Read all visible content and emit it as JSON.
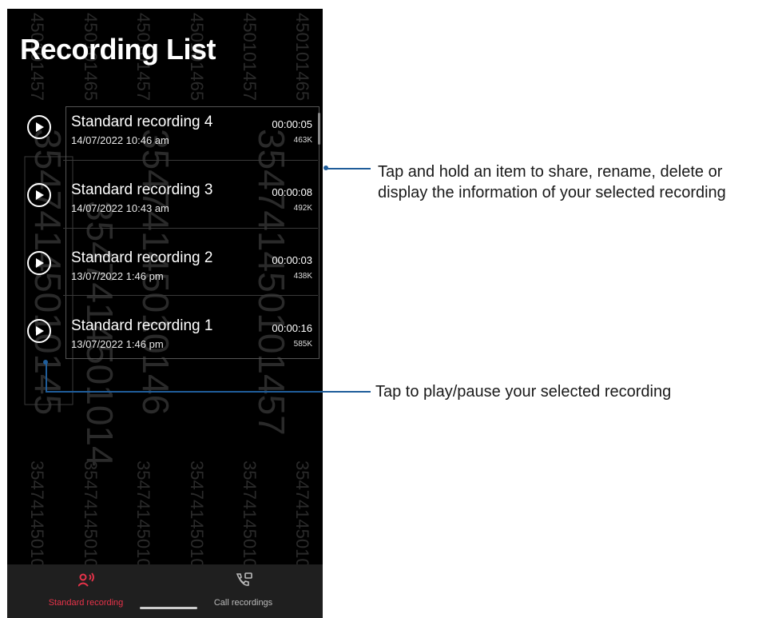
{
  "screen": {
    "title": "Recording List",
    "recordings": [
      {
        "name": "Standard recording 4",
        "date": "14/07/2022 10:46 am",
        "duration": "00:00:05",
        "size": "463K"
      },
      {
        "name": "Standard recording 3",
        "date": "14/07/2022 10:43 am",
        "duration": "00:00:08",
        "size": "492K"
      },
      {
        "name": "Standard recording 2",
        "date": "13/07/2022 1:46 pm",
        "duration": "00:00:03",
        "size": "438K"
      },
      {
        "name": "Standard recording 1",
        "date": "13/07/2022 1:46 pm",
        "duration": "00:00:16",
        "size": "585K"
      }
    ],
    "bottom_nav": {
      "standard": {
        "label": "Standard recording",
        "icon": "standard-recording-icon",
        "active": true
      },
      "call": {
        "label": "Call recordings",
        "icon": "call-recordings-icon",
        "active": false
      }
    },
    "watermark": [
      "450101457",
      "450101465",
      "35474145010145",
      "3547414501014",
      "35474145010146",
      "354741450101457"
    ]
  },
  "callouts": {
    "hold": "Tap and hold an item to share, rename, delete or display the information of your selected recording",
    "hold_line1": "Tap and hold an item to share, rename, delete or",
    "hold_line2": "display the information of your selected recording",
    "play": "Tap to play/pause your selected recording"
  },
  "colors": {
    "accent": "#e8334a",
    "callout_line": "#1f5d9a",
    "background": "#000000",
    "nav_background": "#1f1f1f"
  }
}
